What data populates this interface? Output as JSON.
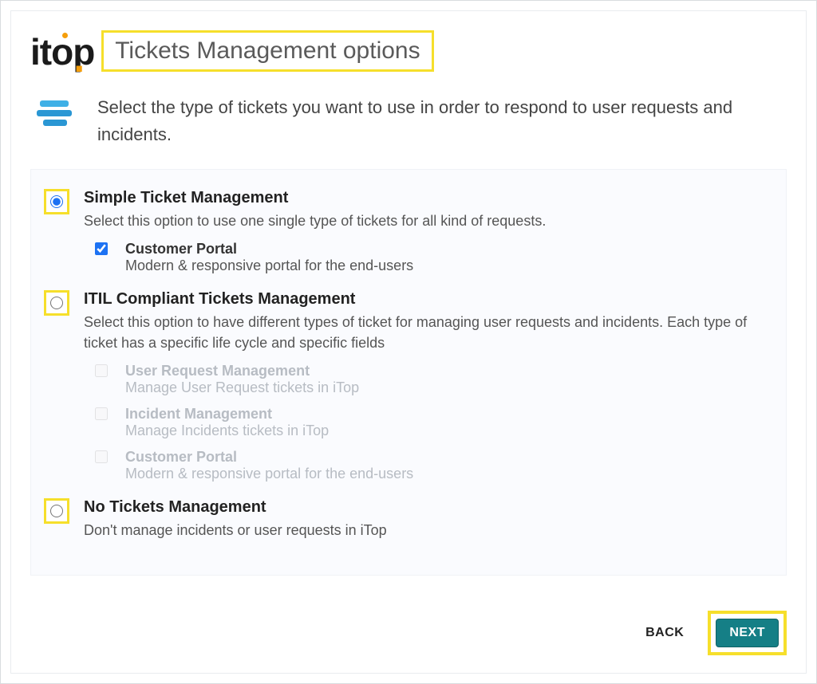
{
  "brand": "itop",
  "page_title": "Tickets Management options",
  "intro": "Select the type of tickets you want to use in order to respond to user requests and incidents.",
  "options": [
    {
      "id": "simple",
      "title": "Simple Ticket Management",
      "desc": "Select this option to use one single type of tickets for all kind of requests.",
      "selected": true,
      "highlight": true,
      "subs": [
        {
          "title": "Customer Portal",
          "desc": "Modern & responsive portal for the end-users",
          "checked": true,
          "enabled": true
        }
      ]
    },
    {
      "id": "itil",
      "title": "ITIL Compliant Tickets Management",
      "desc": "Select this option to have different types of ticket for managing user requests and incidents. Each type of ticket has a specific life cycle and specific fields",
      "selected": false,
      "highlight": true,
      "subs": [
        {
          "title": "User Request Management",
          "desc": "Manage User Request tickets in iTop",
          "checked": false,
          "enabled": false
        },
        {
          "title": "Incident Management",
          "desc": "Manage Incidents tickets in iTop",
          "checked": false,
          "enabled": false
        },
        {
          "title": "Customer Portal",
          "desc": "Modern & responsive portal for the end-users",
          "checked": false,
          "enabled": false
        }
      ]
    },
    {
      "id": "none",
      "title": "No Tickets Management",
      "desc": "Don't manage incidents or user requests in iTop",
      "selected": false,
      "highlight": true,
      "subs": []
    }
  ],
  "buttons": {
    "back": "BACK",
    "next": "NEXT"
  },
  "colors": {
    "highlight": "#f6df2b",
    "primary": "#157f86",
    "accent": "#f59e0b",
    "radio": "#1d72f3"
  }
}
